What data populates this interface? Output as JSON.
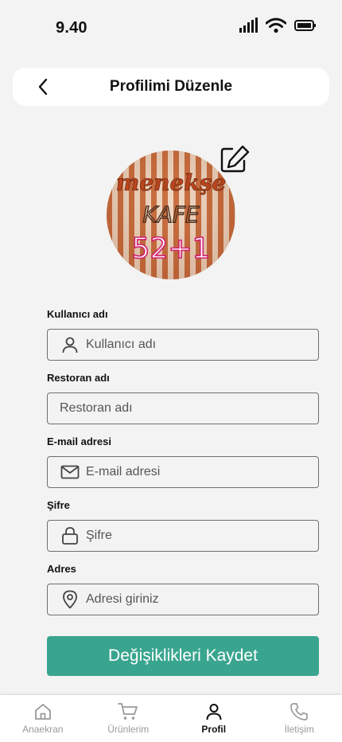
{
  "status_bar": {
    "time": "9.40"
  },
  "header": {
    "title": "Profilimi Düzenle"
  },
  "avatar": {
    "image_lines": [
      "menekşe",
      "KAFE",
      "52+1"
    ]
  },
  "form": {
    "username": {
      "label": "Kullanıcı adı",
      "placeholder": "Kullanıcı adı",
      "icon": "user-icon"
    },
    "restaurant": {
      "label": "Restoran adı",
      "placeholder": "Restoran adı"
    },
    "email": {
      "label": "E-mail adresi",
      "placeholder": "E-mail adresi",
      "icon": "mail-icon"
    },
    "password": {
      "label": "Şifre",
      "placeholder": "Şifre",
      "icon": "lock-icon"
    },
    "address": {
      "label": "Adres",
      "placeholder": "Adresi giriniz",
      "icon": "location-pin-icon"
    },
    "save_label": "Değişiklikleri Kaydet"
  },
  "tabs": [
    {
      "label": "Anaekran",
      "icon": "home-icon",
      "active": false
    },
    {
      "label": "Ürünlerim",
      "icon": "cart-icon",
      "active": false
    },
    {
      "label": "Profil",
      "icon": "user-icon",
      "active": true
    },
    {
      "label": "İletişim",
      "icon": "phone-icon",
      "active": false
    }
  ],
  "colors": {
    "accent": "#3aa58f",
    "background": "#f3f3f3",
    "inactive_tab": "#9a9a9a"
  }
}
